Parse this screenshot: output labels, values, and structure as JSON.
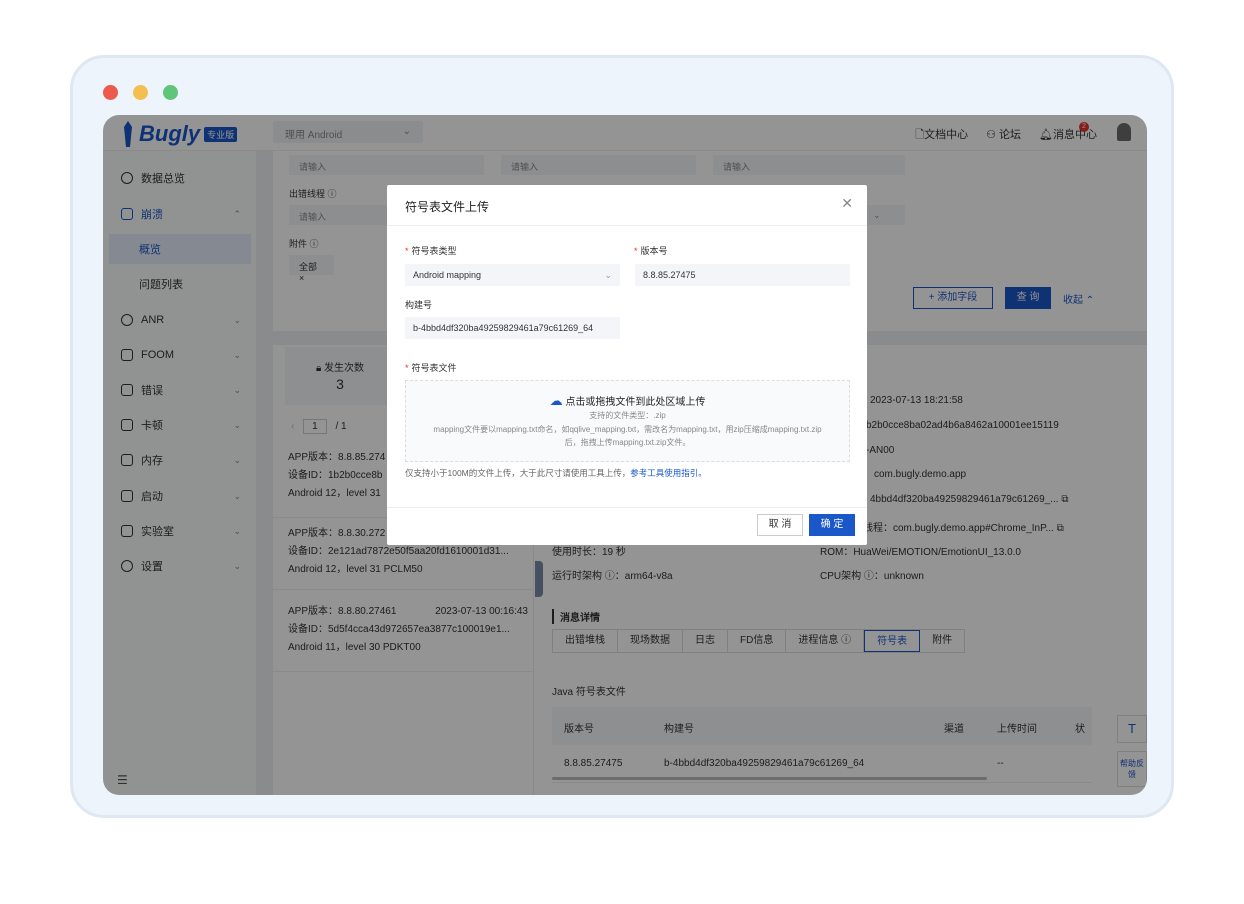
{
  "window": {
    "traffic_lights": [
      "#ec5a4c",
      "#f4bf4f",
      "#60c47b"
    ]
  },
  "topbar": {
    "logo_text": "Bugly",
    "logo_badge": "专业版",
    "app_select": "理用 Android",
    "links": [
      "文档中心",
      "论坛",
      "消息中心"
    ],
    "message_count": "2"
  },
  "sidebar": {
    "items": [
      {
        "label": "数据总览",
        "icon": "clock-icon"
      },
      {
        "label": "崩溃",
        "icon": "crash-icon",
        "expanded": true
      },
      {
        "label": "概览",
        "sub": true,
        "active": true
      },
      {
        "label": "问题列表",
        "sub": true
      },
      {
        "label": "ANR",
        "icon": "anr-icon"
      },
      {
        "label": "FOOM",
        "icon": "foom-icon"
      },
      {
        "label": "错误",
        "icon": "error-icon"
      },
      {
        "label": "卡顿",
        "icon": "lag-icon"
      },
      {
        "label": "内存",
        "icon": "memory-icon"
      },
      {
        "label": "启动",
        "icon": "launch-icon"
      },
      {
        "label": "实验室",
        "icon": "lab-icon"
      },
      {
        "label": "设置",
        "icon": "settings-icon"
      }
    ]
  },
  "filters": {
    "placeholder": "请输入",
    "thread_label": "出错线程",
    "attachment_label": "附件",
    "attachment_value": "全部",
    "add_field": "+ 添加字段",
    "query": "查 询",
    "collapse": "收起"
  },
  "stats": {
    "occurrences_label": "发生次数",
    "occurrences_value": "3"
  },
  "pagination": {
    "current": "1",
    "total": "/ 1"
  },
  "list": [
    {
      "app": "APP版本：8.8.85.274",
      "device": "设备ID：1b2b0cce8b",
      "os": "Android 12，level 31"
    },
    {
      "app": "APP版本：8.8.30.272",
      "device": "设备ID：2e121ad7872e50f5aa20fd1610001d31...",
      "os": "Android 12，level 31   PCLM50"
    },
    {
      "app": "APP版本：8.8.80.27461",
      "time": "2023-07-13 00:16:43",
      "device": "设备ID：5d5f4cca43d972657ea3877c100019e1...",
      "os": "Android 11，level 30   PDKT00"
    }
  ],
  "detail": {
    "time": "2023-07-13 18:21:58",
    "device_id": "b2b0cce8ba02ad4b6a8462a10001ee15119",
    "model": "-AN00",
    "package": "com.bugly.demo.app",
    "build": "4bbd4df320ba49259829461a79c61269_...",
    "thread": "线程：com.bugly.demo.app#Chrome_InP...",
    "uptime": "使用时长：19 秒",
    "rom": "ROM：HuaWei/EMOTION/EmotionUI_13.0.0",
    "arch": "运行时架构 ⓘ：arm64-v8a",
    "cpu": "CPU架构 ⓘ：unknown",
    "section_title": "消息详情",
    "tabs": [
      "出错堆栈",
      "现场数据",
      "日志",
      "FD信息",
      "进程信息 ⓘ",
      "符号表",
      "附件"
    ],
    "table_title": "Java 符号表文件",
    "table_headers": [
      "版本号",
      "构建号",
      "渠道",
      "上传时间",
      "状"
    ],
    "table_row": [
      "8.8.85.27475",
      "b-4bbd4df320ba49259829461a79c61269_64",
      "--"
    ]
  },
  "float": {
    "top": "T",
    "help": "帮助反馈"
  },
  "modal": {
    "title": "符号表文件上传",
    "type_label": "符号表类型",
    "type_value": "Android mapping",
    "version_label": "版本号",
    "version_value": "8.8.85.27475",
    "build_label": "构建号",
    "build_value": "b-4bbd4df320ba49259829461a79c61269_64",
    "file_label": "符号表文件",
    "upload_title": "点击或拖拽文件到此处区域上传",
    "upload_types": "支持的文件类型：.zip",
    "upload_hint1": "mapping文件要以mapping.txt命名，如qqlive_mapping.txt，需改名为mapping.txt，用zip压缩成mapping.txt.zip",
    "upload_hint2": "后，拖拽上传mapping.txt.zip文件。",
    "size_note": "仅支持小于100M的文件上传，大于此尺寸请使用工具上传，",
    "size_link": "参考工具使用指引。",
    "cancel": "取 消",
    "confirm": "确 定"
  }
}
